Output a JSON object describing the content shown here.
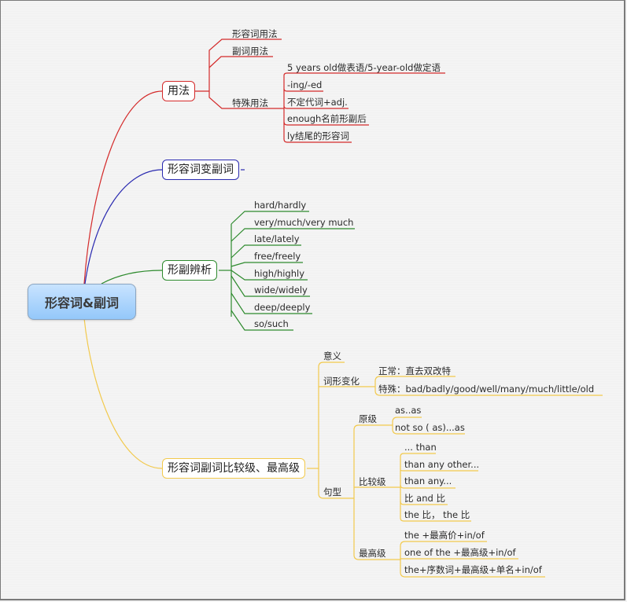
{
  "central": {
    "label": "形容词&副词"
  },
  "colors": {
    "red": "#d42a2a",
    "blue": "#2a2ab0",
    "green": "#2d8a2d",
    "yellow": "#f2c94c"
  },
  "branches": {
    "usage": {
      "label": "用法",
      "children": {
        "adj_usage": "形容词用法",
        "adv_usage": "副词用法",
        "special": {
          "label": "特殊用法",
          "items": [
            "5 years old做表语/5-year-old做定语",
            "-ing/-ed",
            "不定代词+adj.",
            "enough名前形副后",
            "ly结尾的形容词"
          ]
        }
      }
    },
    "adj_to_adv": {
      "label": "形容词变副词"
    },
    "distinguish": {
      "label": "形副辨析",
      "items": [
        "hard/hardly",
        "very/much/very much",
        "late/lately",
        "free/freely",
        "high/highly",
        "wide/widely",
        "deep/deeply",
        "so/such"
      ]
    },
    "comparison": {
      "label": "形容词副词比较级、最高级",
      "meaning": "意义",
      "form_change": {
        "label": "词形变化",
        "items": [
          "正常：直去双改特",
          "特殊：bad/badly/good/well/many/much/little/old"
        ]
      },
      "patterns": {
        "label": "句型",
        "positive": {
          "label": "原级",
          "items": [
            "as..as",
            "not so ( as)...as"
          ]
        },
        "comparative": {
          "label": "比较级",
          "items": [
            "... than",
            "than any other...",
            "than  any...",
            "比 and 比",
            "the 比， the 比"
          ]
        },
        "superlative": {
          "label": "最高级",
          "items": [
            "the +最高价+in/of",
            "one of the +最高级+in/of",
            "the+序数词+最高级+单名+in/of"
          ]
        }
      }
    }
  }
}
